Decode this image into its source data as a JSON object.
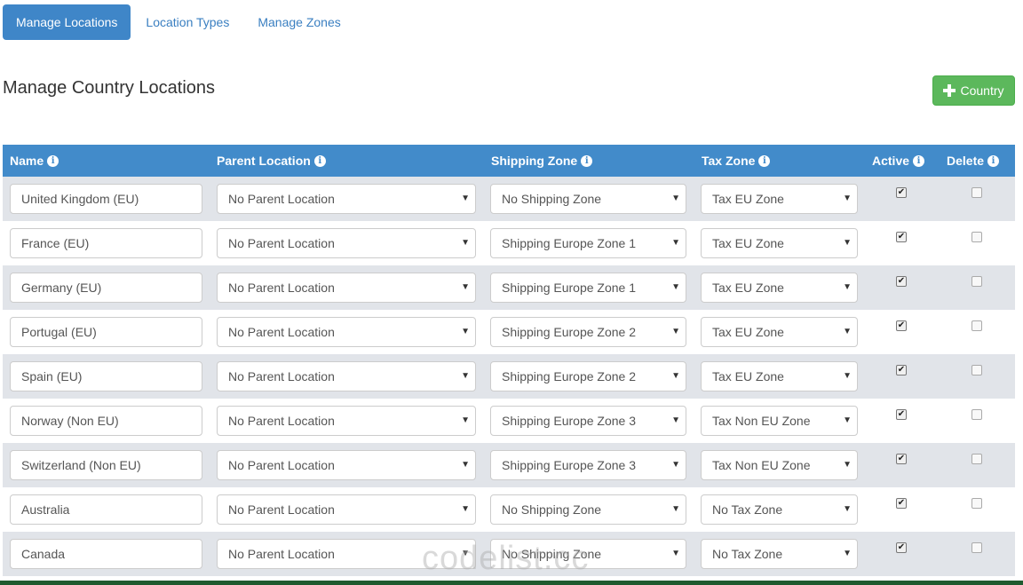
{
  "tabs": [
    {
      "label": "Manage Locations",
      "active": true
    },
    {
      "label": "Location Types",
      "active": false
    },
    {
      "label": "Manage Zones",
      "active": false
    }
  ],
  "page_title": "Manage Country Locations",
  "add_button_label": "Country",
  "columns": [
    "Name",
    "Parent Location",
    "Shipping Zone",
    "Tax Zone",
    "Active",
    "Delete"
  ],
  "rows": [
    {
      "name": "United Kingdom (EU)",
      "parent": "No Parent Location",
      "shipping": "No Shipping Zone",
      "tax": "Tax EU Zone",
      "active": true,
      "delete": false
    },
    {
      "name": "France (EU)",
      "parent": "No Parent Location",
      "shipping": "Shipping Europe Zone 1",
      "tax": "Tax EU Zone",
      "active": true,
      "delete": false
    },
    {
      "name": "Germany (EU)",
      "parent": "No Parent Location",
      "shipping": "Shipping Europe Zone 1",
      "tax": "Tax EU Zone",
      "active": true,
      "delete": false
    },
    {
      "name": "Portugal (EU)",
      "parent": "No Parent Location",
      "shipping": "Shipping Europe Zone 2",
      "tax": "Tax EU Zone",
      "active": true,
      "delete": false
    },
    {
      "name": "Spain (EU)",
      "parent": "No Parent Location",
      "shipping": "Shipping Europe Zone 2",
      "tax": "Tax EU Zone",
      "active": true,
      "delete": false
    },
    {
      "name": "Norway (Non EU)",
      "parent": "No Parent Location",
      "shipping": "Shipping Europe Zone 3",
      "tax": "Tax Non EU Zone",
      "active": true,
      "delete": false
    },
    {
      "name": "Switzerland (Non EU)",
      "parent": "No Parent Location",
      "shipping": "Shipping Europe Zone 3",
      "tax": "Tax Non EU Zone",
      "active": true,
      "delete": false
    },
    {
      "name": "Australia",
      "parent": "No Parent Location",
      "shipping": "No Shipping Zone",
      "tax": "No Tax Zone",
      "active": true,
      "delete": false
    },
    {
      "name": "Canada",
      "parent": "No Parent Location",
      "shipping": "No Shipping Zone",
      "tax": "No Tax Zone",
      "active": true,
      "delete": false
    }
  ],
  "watermark": "codelist.cc",
  "colors": {
    "primary": "#428bca",
    "success": "#5cb85c",
    "row_alt": "#e1e4e9"
  }
}
